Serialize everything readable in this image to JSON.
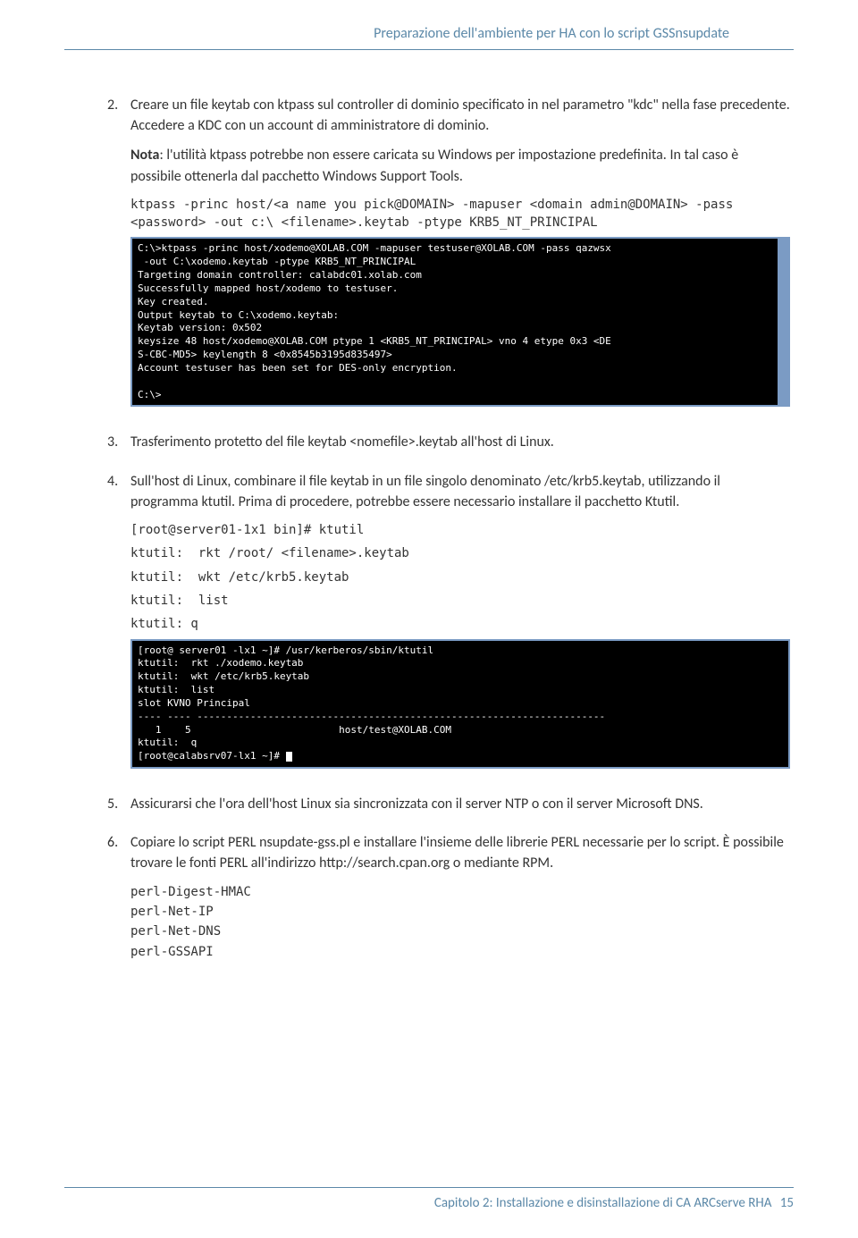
{
  "header": {
    "title": "Preparazione dell'ambiente per HA con lo script GSSnsupdate"
  },
  "steps": {
    "s2": {
      "num": "2.",
      "p1": "Creare un file keytab con ktpass sul controller di dominio specificato in nel parametro \"kdc\" nella fase precedente. Accedere a KDC con un account di amministratore di dominio.",
      "p2a": "Nota",
      "p2b": ": l'utilità ktpass potrebbe non essere caricata su Windows per impostazione predefinita. In tal caso è possibile ottenerla dal pacchetto Windows Support Tools.",
      "code": "ktpass -princ host/<a name you pick@DOMAIN> -mapuser <domain admin@DOMAIN> -pass <password> -out c:\\ <filename>.keytab -ptype KRB5_NT_PRINCIPAL",
      "term": "C:\\>ktpass -princ host/xodemo@XOLAB.COM -mapuser testuser@XOLAB.COM -pass qazwsx\n -out C:\\xodemo.keytab -ptype KRB5_NT_PRINCIPAL\nTargeting domain controller: calabdc01.xolab.com\nSuccessfully mapped host/xodemo to testuser.\nKey created.\nOutput keytab to C:\\xodemo.keytab:\nKeytab version: 0x502\nkeysize 48 host/xodemo@XOLAB.COM ptype 1 <KRB5_NT_PRINCIPAL> vno 4 etype 0x3 <DE\nS-CBC-MD5> keylength 8 <0x8545b3195d835497>\nAccount testuser has been set for DES-only encryption.\n\nC:\\>"
    },
    "s3": {
      "num": "3.",
      "p1": "Trasferimento protetto del file keytab <nomefile>.keytab all'host di Linux."
    },
    "s4": {
      "num": "4.",
      "p1": "Sull'host di Linux, combinare il file keytab in un file singolo denominato /etc/krb5.keytab, utilizzando il programma ktutil. Prima di procedere, potrebbe essere necessario installare il pacchetto Ktutil.",
      "c1": "[root@server01-1x1 bin]# ktutil",
      "c2": "ktutil:  rkt /root/ <filename>.keytab",
      "c3": "ktutil:  wkt /etc/krb5.keytab",
      "c4": "ktutil:  list",
      "c5": "ktutil: q",
      "term": "[root@ server01 -lx1 ~]# /usr/kerberos/sbin/ktutil\nktutil:  rkt ./xodemo.keytab\nktutil:  wkt /etc/krb5.keytab\nktutil:  list\nslot KVNO Principal\n---- ---- ---------------------------------------------------------------------\n   1    5                         host/test@XOLAB.COM\nktutil:  q\n[root@calabsrv07-lx1 ~]# "
    },
    "s5": {
      "num": "5.",
      "p1": "Assicurarsi che l'ora dell'host Linux sia sincronizzata con il server NTP o con il server Microsoft DNS."
    },
    "s6": {
      "num": "6.",
      "p1": "Copiare lo script PERL nsupdate-gss.pl e installare l'insieme delle librerie PERL necessarie per lo script. È possibile trovare le fonti PERL all'indirizzo http://search.cpan.org o mediante RPM.",
      "c1": "perl-Digest-HMAC",
      "c2": "perl-Net-IP",
      "c3": "perl-Net-DNS",
      "c4": "perl-GSSAPI"
    }
  },
  "footer": {
    "chapter": "Capitolo 2: Installazione e disinstallazione di CA ARCserve RHA",
    "page": "15"
  }
}
